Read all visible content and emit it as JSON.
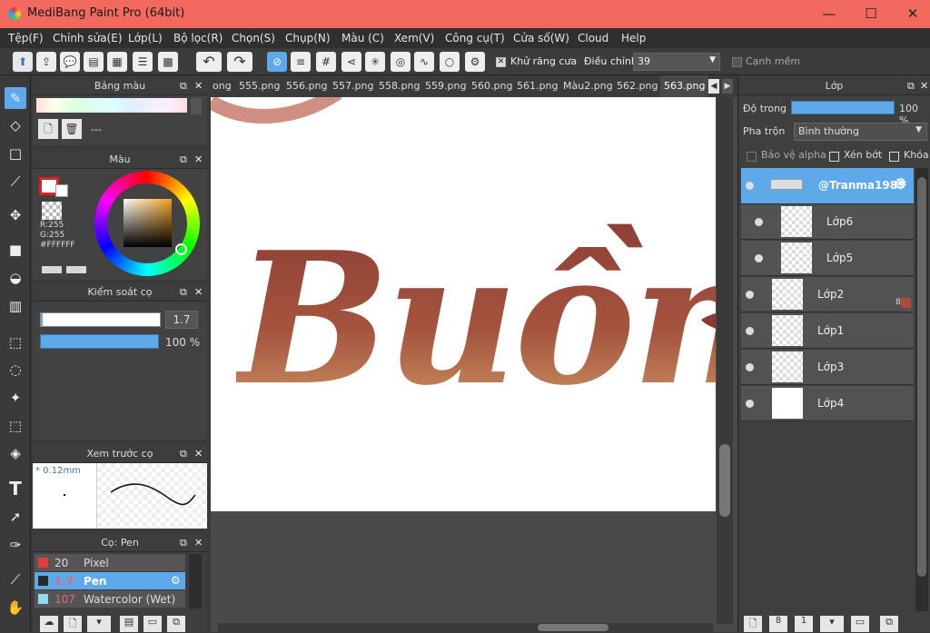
{
  "window": {
    "title": "MediBang Paint Pro (64bit)"
  },
  "menu": [
    "Tệp(F)",
    "Chỉnh sửa(E)",
    "Lớp(L)",
    "Bộ lọc(R)",
    "Chọn(S)",
    "Chụp(N)",
    "Màu (C)",
    "Xem(V)",
    "Công cụ(T)",
    "Cửa sổ(W)",
    "Cloud",
    "Help"
  ],
  "toolbar": {
    "antialias_label": "Khử răng cưa",
    "correction_label": "Điều chỉnh",
    "correction_value": "39",
    "smooth_label": "Cạnh mềm"
  },
  "palette_panel": {
    "title": "Bảng màu",
    "dash": "---"
  },
  "color_panel": {
    "title": "Màu",
    "r": "R:255",
    "g": "G:255",
    "hex": "#FFFFFF"
  },
  "brush_control": {
    "title": "Kiểm soát cọ",
    "size": "1.7",
    "opacity": "100 %"
  },
  "brush_preview": {
    "title": "Xem trước cọ",
    "size": "* 0.12mm"
  },
  "brush_list": {
    "title": "Cọ: Pen",
    "items": [
      {
        "size": "20",
        "name": "Pixel",
        "color": "#e83a3a"
      },
      {
        "size": "1.7",
        "name": "Pen",
        "color": "#2a2a2a"
      },
      {
        "size": "107",
        "name": "Watercolor (Wet)",
        "color": "#8fd8f0"
      }
    ]
  },
  "tabs": [
    "ong",
    "555.png",
    "556.png",
    "557.png",
    "558.png",
    "559.png",
    "560.png",
    "561.png",
    "Màu2.png",
    "562.png",
    "563.png"
  ],
  "canvas": {
    "artwork_text": "Buồn"
  },
  "layers_panel": {
    "title": "Lớp",
    "opacity_label": "Độ trong",
    "opacity_value": "100 %",
    "opacity_fraction": 1.0,
    "blend_label": "Pha trộn",
    "blend_value": "Bình thường",
    "protect_alpha": "Bảo vệ alpha",
    "clip": "Xén bớt",
    "lock": "Khóa",
    "folder_name": "@Tranma1989",
    "layers": [
      {
        "name": "Lớp6"
      },
      {
        "name": "Lớp5"
      },
      {
        "name": "Lớp2",
        "badge": "8"
      },
      {
        "name": "Lớp1"
      },
      {
        "name": "Lớp3"
      },
      {
        "name": "Lớp4"
      }
    ]
  },
  "colors": {
    "accent": "#5da9e9",
    "title_bar": "#f26a5f",
    "brand_ink": "#8b3a33"
  }
}
